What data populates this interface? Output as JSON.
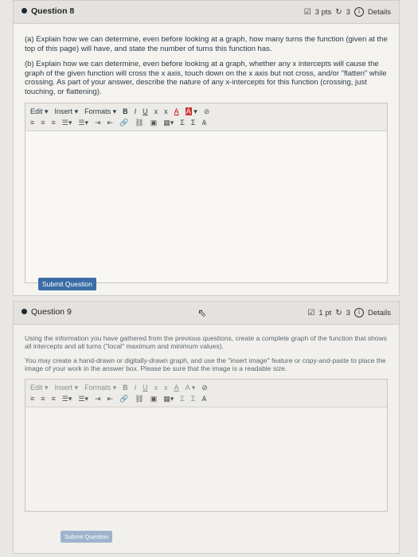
{
  "q1": {
    "title": "Question 8",
    "points": "3 pts",
    "attempts": "3",
    "details": "Details",
    "part_a": "(a) Explain how we can determine, even before looking at a graph, how many turns the function (given at the top of this page) will have, and state the number of turns this function has.",
    "part_b": "(b) Explain how we can determine, even before looking at a graph, whether any x intercepts will cause the graph of the given function will cross the x axis, touch down on the x axis but not cross, and/or \"flatten\" while crossing. As part of your answer, describe the nature of any x-intercepts for this function (crossing, just touching, or flattening).",
    "submit": "Submit Question"
  },
  "q2": {
    "title": "Question 9",
    "points": "1 pt",
    "attempts": "3",
    "details": "Details",
    "p1": "Using the information you have gathered from the previous questions, create a complete graph of the function that shows all intercepts and all turns (\"local\" maximum and minimum values).",
    "p2": "You may create a hand-drawn or digitally-drawn graph, and use the \"insert image\" feature or copy-and-paste to place the image of your work in the answer box. Please be sure that the image is a readable size.",
    "submit": "Submit Question"
  },
  "toolbar": {
    "edit": "Edit",
    "insert": "Insert",
    "formats": "Formats",
    "bold": "B",
    "italic": "I",
    "underline": "U",
    "sub": "x",
    "sup": "x",
    "font_color": "A",
    "bg_color": "A",
    "sigma1": "Σ",
    "sigma2": "Σ"
  }
}
